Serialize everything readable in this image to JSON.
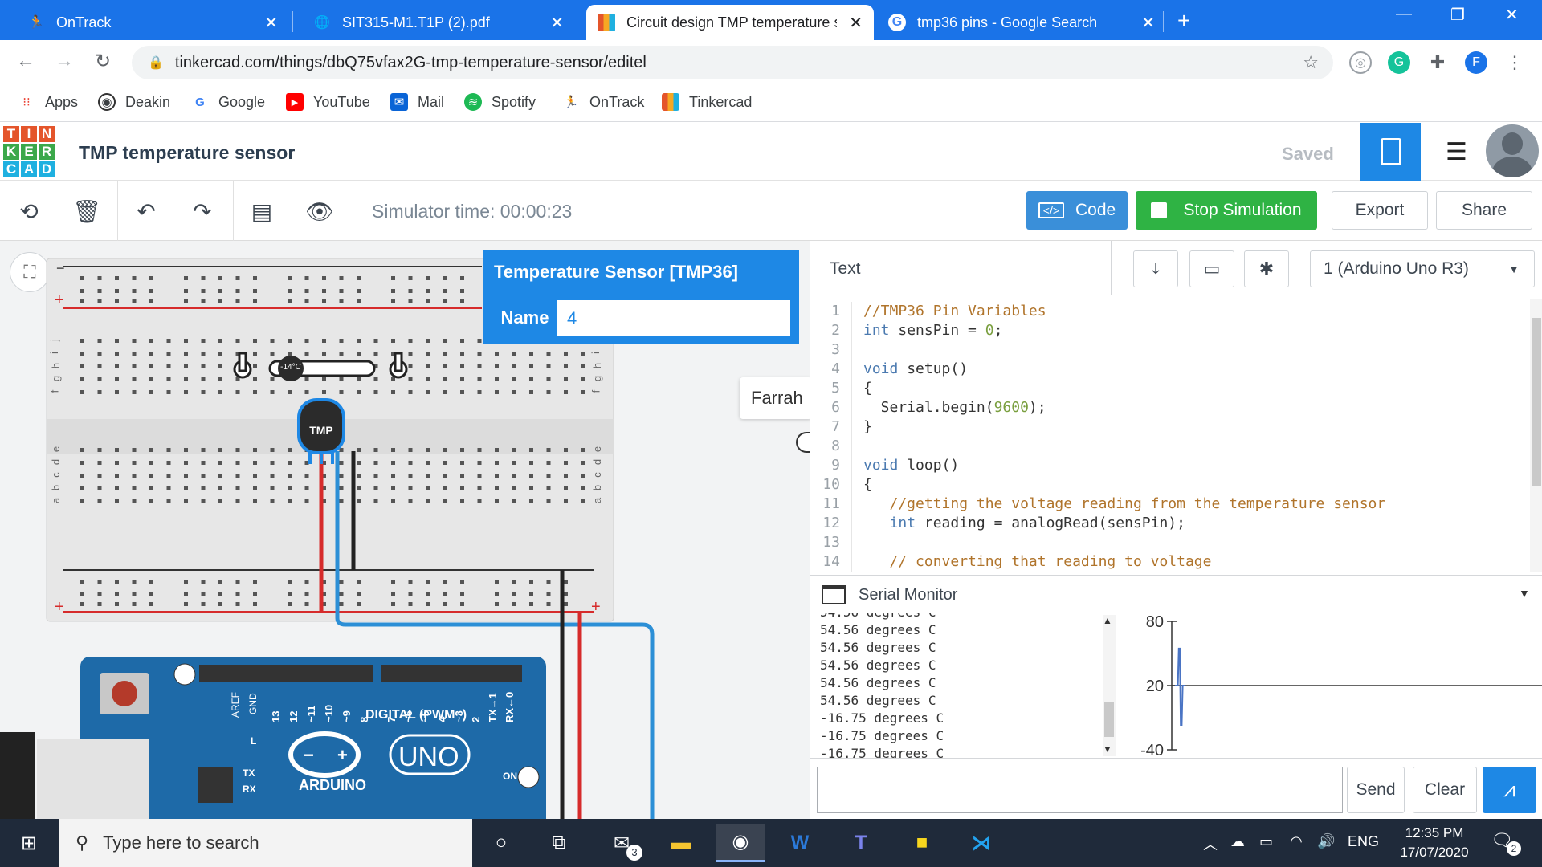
{
  "browser": {
    "tabs": [
      {
        "title": "OnTrack",
        "icon": "ontrack-icon"
      },
      {
        "title": "SIT315-M1.T1P (2).pdf",
        "icon": "globe-icon"
      },
      {
        "title": "Circuit design TMP temperature s",
        "icon": "tinkercad-icon"
      },
      {
        "title": "tmp36 pins - Google Search",
        "icon": "google-icon"
      }
    ],
    "new_tab": "+",
    "url": "tinkercad.com/things/dbQ75vfax2G-tmp-temperature-sensor/editel",
    "profile_initial": "F",
    "bookmarks": [
      {
        "label": "Apps",
        "icon": "apps-icon"
      },
      {
        "label": "Deakin",
        "icon": "deakin-icon"
      },
      {
        "label": "Google",
        "icon": "google-icon"
      },
      {
        "label": "YouTube",
        "icon": "youtube-icon"
      },
      {
        "label": "Mail",
        "icon": "mail-icon"
      },
      {
        "label": "Spotify",
        "icon": "spotify-icon"
      },
      {
        "label": "OnTrack",
        "icon": "ontrack-icon"
      },
      {
        "label": "Tinkercad",
        "icon": "tinkercad-icon"
      }
    ]
  },
  "tinkercad": {
    "logo_letters": [
      "T",
      "I",
      "N",
      "K",
      "E",
      "R",
      "C",
      "A",
      "D"
    ],
    "project_title": "TMP temperature sensor",
    "save_status": "Saved",
    "sim_time": "Simulator time: 00:00:23",
    "buttons": {
      "code": "Code",
      "stop": "Stop Simulation",
      "export": "Export",
      "share": "Share"
    },
    "colors": {
      "accent": "#1e88e5",
      "green": "#2fb344",
      "code_btn": "#3a8fd9"
    }
  },
  "popup": {
    "title": "Temperature Sensor [TMP36]",
    "name_label": "Name",
    "name_value": "4"
  },
  "collaborator": "Farrah",
  "circuit": {
    "sensor_label": "TMP",
    "slider_temp": "-14°C",
    "board_labels": [
      "DIGITAL (PWM~)",
      "ARDUINO",
      "UNO",
      "ON",
      "TX",
      "RX",
      "L",
      "AREF",
      "GND"
    ],
    "pin_labels": [
      "13",
      "12",
      "~11",
      "~10",
      "~9",
      "8",
      "7",
      "~6",
      "~5",
      "4",
      "~3",
      "2",
      "TX→1",
      "RX←0"
    ],
    "row_letters_top": [
      "j",
      "i",
      "h",
      "g",
      "f"
    ],
    "row_letters_bottom": [
      "e",
      "d",
      "c",
      "b",
      "a"
    ]
  },
  "code_panel": {
    "mode": "Text",
    "board": "1 (Arduino Uno R3)",
    "lines": [
      {
        "n": "1",
        "text": "//TMP36 Pin Variables",
        "cls": "cm"
      },
      {
        "n": "2",
        "text": "int sensPin = 0;",
        "cls": "tx"
      },
      {
        "n": "3",
        "text": "",
        "cls": "tx"
      },
      {
        "n": "4",
        "text": "void setup()",
        "cls": "tx"
      },
      {
        "n": "5",
        "text": "{",
        "cls": "tx"
      },
      {
        "n": "6",
        "text": "  Serial.begin(9600);",
        "cls": "tx"
      },
      {
        "n": "7",
        "text": "}",
        "cls": "tx"
      },
      {
        "n": "8",
        "text": "",
        "cls": "tx"
      },
      {
        "n": "9",
        "text": "void loop()",
        "cls": "tx"
      },
      {
        "n": "10",
        "text": "{",
        "cls": "tx"
      },
      {
        "n": "11",
        "text": "   //getting the voltage reading from the temperature sensor",
        "cls": "cm"
      },
      {
        "n": "12",
        "text": "   int reading = analogRead(sensPin);",
        "cls": "tx"
      },
      {
        "n": "13",
        "text": "",
        "cls": "tx"
      },
      {
        "n": "14",
        "text": "   // converting that reading to voltage",
        "cls": "cm"
      }
    ],
    "serial_title": "Serial Monitor",
    "serial_lines": [
      "54.56 degrees C",
      "54.56 degrees C",
      "54.56 degrees C",
      "54.56 degrees C",
      "54.56 degrees C",
      "54.56 degrees C",
      "-16.75 degrees C",
      "-16.75 degrees C",
      "-16.75 degrees C"
    ],
    "send": "Send",
    "clear": "Clear"
  },
  "chart_data": {
    "type": "line",
    "title": "",
    "xlabel": "",
    "ylabel": "",
    "ylim": [
      -40,
      80
    ],
    "yticks": [
      "80",
      "20",
      "-40"
    ],
    "series": [
      {
        "values": [
          20,
          20,
          20,
          20,
          54.56,
          54.56,
          -16.75,
          -16.75,
          20,
          20,
          20,
          20
        ]
      }
    ]
  },
  "taskbar": {
    "search_placeholder": "Type here to search",
    "mail_badge": "3",
    "language": "ENG",
    "time": "12:35 PM",
    "date": "17/07/2020",
    "notification_count": "2"
  }
}
